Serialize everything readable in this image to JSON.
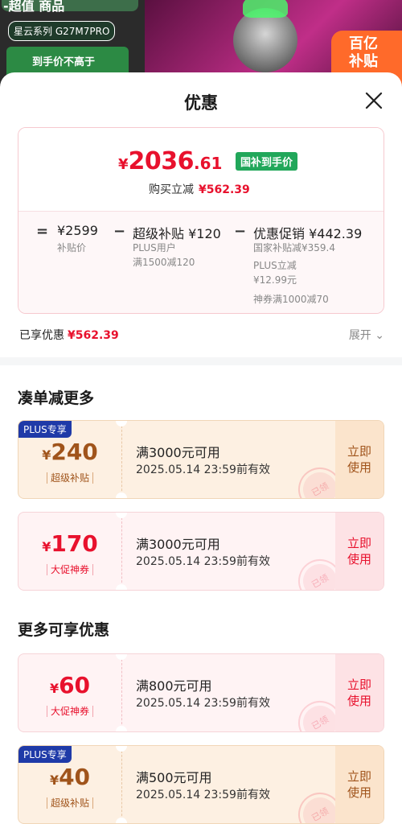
{
  "background": {
    "top_text": "-超值 商品",
    "product_tag": "星云系列 G27M7PRO",
    "green_label": "到手价不高于",
    "badge_text": "百亿补贴"
  },
  "sheet": {
    "title": "优惠",
    "close_icon": "close-icon"
  },
  "price_box": {
    "yen": "¥",
    "final_int": "2036",
    "final_dec": ".61",
    "tag": "国补到手价",
    "buy_reduce_label": "购买立减",
    "buy_reduce_value": "¥562.39",
    "calc": {
      "eq": "=",
      "base_price": "¥2599",
      "base_label": "补贴价",
      "minus1": "−",
      "super_label": "超级补贴 ¥120",
      "super_sub1": "PLUS用户",
      "super_sub2": "满1500减120",
      "minus2": "−",
      "promo_label": "优惠促销 ¥442.39",
      "promo_sub1": "国家补贴减¥359.4",
      "promo_sub2": "PLUS立减",
      "promo_sub3": "¥12.99元",
      "promo_sub4": "神券满1000减70"
    }
  },
  "enjoyed": {
    "label": "已享优惠",
    "value": "¥562.39",
    "expand_label": "展开 ⌄"
  },
  "sections": {
    "more_reduce": "凑单减更多",
    "more_available": "更多可享优惠"
  },
  "coupons": [
    {
      "tag": "PLUS专享",
      "yen": "¥",
      "amount": "240",
      "category": "超级补贴",
      "condition": "满3000元可用",
      "valid": "2025.05.14 23:59前有效",
      "use_label": "立即使用",
      "stamp": "已领"
    },
    {
      "tag": "",
      "yen": "¥",
      "amount": "170",
      "category": "大促神券",
      "condition": "满3000元可用",
      "valid": "2025.05.14 23:59前有效",
      "use_label": "立即使用",
      "stamp": "已领"
    },
    {
      "tag": "",
      "yen": "¥",
      "amount": "60",
      "category": "大促神券",
      "condition": "满800元可用",
      "valid": "2025.05.14 23:59前有效",
      "use_label": "立即使用",
      "stamp": "已领"
    },
    {
      "tag": "PLUS专享",
      "yen": "¥",
      "amount": "40",
      "category": "超级补贴",
      "condition": "满500元可用",
      "valid": "2025.05.14 23:59前有效",
      "use_label": "立即使用",
      "stamp": "已领"
    }
  ],
  "colors": {
    "accent_red": "#e8112d",
    "plus_brown": "#a0541b",
    "green_tag": "#21a75a",
    "plus_tag_blue": "#1f3aa8"
  }
}
